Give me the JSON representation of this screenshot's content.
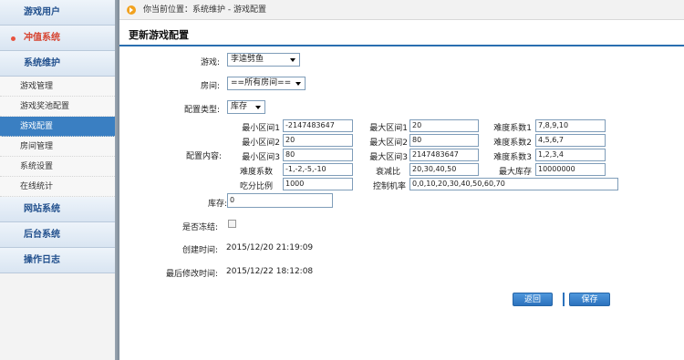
{
  "sidebar": {
    "sections": [
      {
        "label": "游戏用户"
      },
      {
        "label": "冲值系统"
      },
      {
        "label": "系统维护"
      },
      {
        "label": "网站系统"
      },
      {
        "label": "后台系统"
      },
      {
        "label": "操作日志"
      }
    ],
    "items": [
      {
        "label": "游戏管理"
      },
      {
        "label": "游戏奖池配置"
      },
      {
        "label": "游戏配置"
      },
      {
        "label": "房间管理"
      },
      {
        "label": "系统设置"
      },
      {
        "label": "在线统计"
      }
    ]
  },
  "breadcrumb": {
    "text": "你当前位置：系统维护 - 游戏配置"
  },
  "page": {
    "title": "更新游戏配置"
  },
  "form": {
    "game": {
      "label": "游戏:",
      "value": "李逵劈鱼"
    },
    "room": {
      "label": "房间:",
      "value": "==所有房间=="
    },
    "config_type": {
      "label": "配置类型:",
      "value": "库存"
    },
    "content_label": "配置内容:",
    "grid": {
      "min1_label": "最小区间1",
      "min1": "-2147483647",
      "max1_label": "最大区间1",
      "max1": "20",
      "diff1_label": "难度系数1",
      "diff1": "7,8,9,10",
      "min2_label": "最小区间2",
      "min2": "20",
      "max2_label": "最大区间2",
      "max2": "80",
      "diff2_label": "难度系数2",
      "diff2": "4,5,6,7",
      "min3_label": "最小区间3",
      "min3": "80",
      "max3_label": "最大区间3",
      "max3": "2147483647",
      "diff3_label": "难度系数3",
      "diff3": "1,2,3,4",
      "difficulty_label": "难度系数",
      "difficulty": "-1,-2,-5,-10",
      "decay_label": "衰减比",
      "decay": "20,30,40,50",
      "maxstock_label": "最大库存",
      "maxstock": "10000000",
      "ratio_label": "吃分比例",
      "ratio": "1000",
      "control_label": "控制机率",
      "control": "0,0,10,20,30,40,50,60,70"
    },
    "stock": {
      "label": "库存:",
      "value": "0"
    },
    "frozen": {
      "label": "是否冻结:"
    },
    "created": {
      "label": "创建时间:",
      "value": "2015/12/20 21:19:09"
    },
    "modified": {
      "label": "最后修改时间:",
      "value": "2015/12/22 18:12:08"
    }
  },
  "buttons": {
    "back": "返回",
    "save": "保存"
  },
  "colors": {
    "accent": "#2c72bd",
    "active_section": "#d64330",
    "selected_item": "#3a7fc2"
  }
}
